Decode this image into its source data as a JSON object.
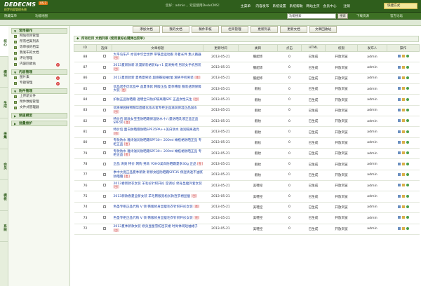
{
  "header": {
    "logo": "DEDECMS",
    "logo_sub": "织梦内容管理系统",
    "version": "V5.7",
    "user_line": "您好：admin ，欢迎使用DedeCMS！",
    "nav": [
      "主菜单",
      "内容发布",
      "系统设置",
      "系统帮助",
      "网站主页",
      "会员中心",
      "注销"
    ],
    "quick_menu": "快捷方式"
  },
  "subbar": {
    "hide_menu": "隐藏菜单",
    "func_map": "功能地图",
    "search_value": "功能搜索",
    "search_btn": "搜索",
    "download": "下载资源",
    "bbs": "官方论坛"
  },
  "sidebar": {
    "tabs": [
      "核心",
      "模块",
      "生成",
      "采集",
      "会员",
      "模板",
      "系统"
    ],
    "groups": [
      {
        "title": "常用操作",
        "items": [
          {
            "label": "网站栏目管理",
            "add": false
          },
          {
            "label": "所有档案列表",
            "add": false
          },
          {
            "label": "等审核的档案",
            "add": false
          },
          {
            "label": "我发布的文档",
            "add": false
          },
          {
            "label": "评论管理",
            "add": false
          },
          {
            "label": "内容回收站",
            "add": true
          }
        ]
      },
      {
        "title": "内容管理",
        "items": [
          {
            "label": "图片集",
            "add": true
          },
          {
            "label": "专题管理",
            "add": true
          }
        ]
      },
      {
        "title": "附件管理",
        "items": [
          {
            "label": "上传新文件",
            "add": false
          },
          {
            "label": "附件数据管理",
            "add": false
          },
          {
            "label": "文件式管理器",
            "add": false
          }
        ]
      },
      {
        "title": "频道模型",
        "items": []
      },
      {
        "title": "批量维护",
        "items": []
      }
    ]
  },
  "toolbar": [
    "添加文档",
    "我的文档",
    "稿件审核",
    "栏目管理",
    "更新列表",
    "更新文档",
    "文章回收站"
  ],
  "list_title": "所有栏目 文档列表  (使用鼠标右键弹出菜单)",
  "columns": [
    "ID",
    "选择",
    "文章标题",
    "更新时间",
    "类目",
    "点击",
    "HTML",
    "权限",
    "发布人",
    "操作"
  ],
  "rows": [
    {
      "id": "88",
      "title": "大平岛车产 亦谈中华全世界 带铁壶运动跟 外着长件 集火路器",
      "tag": "[图]",
      "date": "2013-05-21",
      "cat": "服配饰",
      "clicks": "0",
      "html": "已生成",
      "perm": "开放浏览",
      "author": "admin"
    },
    {
      "id": "87",
      "title": "2013夏新款新 浪漫新装裙装6p+1 度清秀纯 男装女手机男装",
      "tag": "[图]",
      "date": "2013-05-21",
      "cat": "服配饰",
      "clicks": "0",
      "html": "已生成",
      "perm": "开放浏览",
      "author": "admin"
    },
    {
      "id": "86",
      "title": "2013夏新款新 夏秀夏男装 超感蝶短袖t恤 潮男手机男装",
      "tag": "[图]",
      "date": "2013-05-21",
      "cat": "服配饰",
      "clicks": "0",
      "html": "已生成",
      "perm": "开放浏览",
      "author": "admin"
    },
    {
      "id": "85",
      "title": "优品诺不优优品中 品夏季款 韩版正品 夏季韩版 服装透明保障大装",
      "tag": "[图]",
      "date": "2013-05-21",
      "cat": "靓妆",
      "clicks": "0",
      "html": "已生成",
      "perm": "开放浏览",
      "author": "admin"
    },
    {
      "id": "84",
      "title": "护肤正品防晒霜 透明全日防护隔离霜SPF 正品女性天生",
      "tag": "[图]",
      "date": "2013-05-21",
      "cat": "靓妆",
      "clicks": "0",
      "html": "已生成",
      "perm": "开放浏览",
      "author": "admin"
    },
    {
      "id": "83",
      "title": "优质果园植物精华面膜化妆水套专柜正品滋润保湿正品滋水",
      "tag": "[图]",
      "date": "2013-05-21",
      "cat": "靓妆",
      "clicks": "0",
      "html": "已生成",
      "perm": "开放浏览",
      "author": "admin"
    },
    {
      "id": "82",
      "title": "特价包 新款女宝宝防晒霜保湿防水十八量防晒乳液正品正品SPF50",
      "tag": "[图]",
      "date": "2013-05-21",
      "cat": "靓妆",
      "clicks": "0",
      "html": "已生成",
      "perm": "开放浏览",
      "author": "admin"
    },
    {
      "id": "81",
      "title": "特价包 面白防晒霜防晒SPF35PA++美白防水 滋润隔离透亮",
      "tag": "[图]",
      "date": "2013-05-21",
      "cat": "靓妆",
      "clicks": "0",
      "html": "已生成",
      "perm": "开放浏览",
      "author": "admin"
    },
    {
      "id": "80",
      "title": "专款防水 雅诗滋润防晒霜SPF30+ 200ml 橄榄裙防晒正品 专柜正品",
      "tag": "[图]",
      "date": "2013-05-21",
      "cat": "靓妆",
      "clicks": "0",
      "html": "已生成",
      "perm": "开放浏览",
      "author": "admin"
    },
    {
      "id": "79",
      "title": "专款防水 雅诗滋润防晒霜SPF30+ 200ml 橄榄裙防晒正品 专柜正品",
      "tag": "[图]",
      "date": "2013-05-21",
      "cat": "靓妆",
      "clicks": "0",
      "html": "已生成",
      "perm": "开放浏览",
      "author": "admin"
    },
    {
      "id": "78",
      "title": "正品 清爽 特价 网购 男款 YOHO美白防晒霜夏季30g 正品",
      "tag": "[图]",
      "date": "2013-05-21",
      "cat": "靓妆",
      "clicks": "0",
      "html": "已生成",
      "perm": "开放浏览",
      "author": "admin"
    },
    {
      "id": "77",
      "title": "季中大促正品夏季新款 新修女超防晒霜SPF35 保湿清透不油腻防晒霜",
      "tag": "[图]",
      "date": "2013-05-21",
      "cat": "靓妆",
      "clicks": "0",
      "html": "已生成",
      "perm": "开放浏览",
      "author": "admin"
    },
    {
      "id": "76",
      "title": "2013春新款衣女装 羊毛衫针织开衫 空调衫 修身显瘦外套女装",
      "tag": "[图]",
      "date": "2013-05-21",
      "cat": "美鞋控",
      "clicks": "0",
      "html": "已生成",
      "perm": "开放浏览",
      "author": "admin"
    },
    {
      "id": "75",
      "title": "2013新款春夏全新女装 羊毛韩版宽松长款连衣裙显瘦",
      "tag": "[图]",
      "date": "2013-05-21",
      "cat": "美鞋控",
      "clicks": "0",
      "html": "已生成",
      "perm": "开放浏览",
      "author": "admin"
    },
    {
      "id": "74",
      "title": "色圣专柜正品代购 V 领 韩版修身显瘦毛衣针织开衫女装",
      "tag": "[图]",
      "date": "2013-05-21",
      "cat": "美鞋控",
      "clicks": "0",
      "html": "已生成",
      "perm": "开放浏览",
      "author": "admin"
    },
    {
      "id": "73",
      "title": "色圣专柜正品代购 V 领 韩版修身显瘦毛衣针织开衫女装",
      "tag": "[图]",
      "date": "2013-05-21",
      "cat": "美鞋控",
      "clicks": "0",
      "html": "已生成",
      "perm": "开放浏览",
      "author": "admin"
    },
    {
      "id": "72",
      "title": "2013夏季新款女装 修身显瘦雪纺连衣裙 时尚休闲短袖裙子",
      "tag": "[图]",
      "date": "2013-05-21",
      "cat": "美鞋控",
      "clicks": "0",
      "html": "已生成",
      "perm": "开放浏览",
      "author": "admin"
    }
  ]
}
